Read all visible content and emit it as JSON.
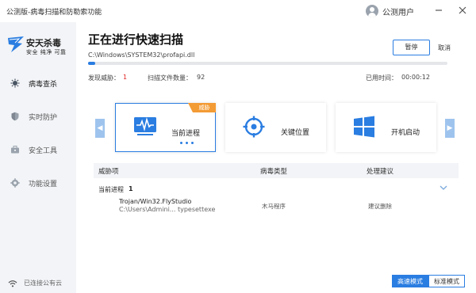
{
  "window": {
    "title": "公测版-病毒扫描和防勒索功能",
    "user_name": "公测用户",
    "minimize_icon": "minimize-icon",
    "close_icon": "close-icon"
  },
  "brand": {
    "name": "安天杀毒",
    "slogan": "安全 纯净 可靠"
  },
  "sidebar": {
    "items": [
      {
        "label": "病毒查杀",
        "icon": "virus-scan-icon",
        "active": true
      },
      {
        "label": "实时防护",
        "icon": "shield-icon",
        "active": false
      },
      {
        "label": "安全工具",
        "icon": "toolbox-icon",
        "active": false
      },
      {
        "label": "功能设置",
        "icon": "gear-icon",
        "active": false
      }
    ],
    "status": "已连接公有云"
  },
  "scan": {
    "title": "正在进行快速扫描",
    "current_path": "C:\\Windows\\SYSTEM32\\profapi.dll",
    "pause_label": "暂停",
    "cancel_label": "取消",
    "progress_percent": 2,
    "threats_label": "发现威胁：",
    "threats_count": "1",
    "files_label": "扫描文件数量：",
    "files_count": "92",
    "elapsed_label": "已用时间：",
    "elapsed_time": "00:00:12"
  },
  "scan_targets": [
    {
      "label": "当前进程",
      "icon": "monitor-pulse-icon",
      "active": true,
      "badge": "威胁"
    },
    {
      "label": "关键位置",
      "icon": "crosshair-icon",
      "active": false
    },
    {
      "label": "开机启动",
      "icon": "windows-icon",
      "active": false
    }
  ],
  "table": {
    "columns": [
      "威胁项",
      "病毒类型",
      "处理建议"
    ],
    "groups": [
      {
        "name": "当前进程",
        "count": "1",
        "rows": [
          {
            "name": "Trojan/Win32.FlyStudio",
            "path": "C:\\Users\\Admini... typesettexe",
            "type": "木马程序",
            "advice": "建议删除"
          }
        ]
      }
    ]
  },
  "modes": {
    "fast": "高速模式",
    "standard": "标准模式",
    "selected": "fast"
  },
  "colors": {
    "accent": "#2a7de1",
    "danger": "#e02020",
    "badge": "#f39b35",
    "sidebar_bg": "#f2f4f7"
  }
}
